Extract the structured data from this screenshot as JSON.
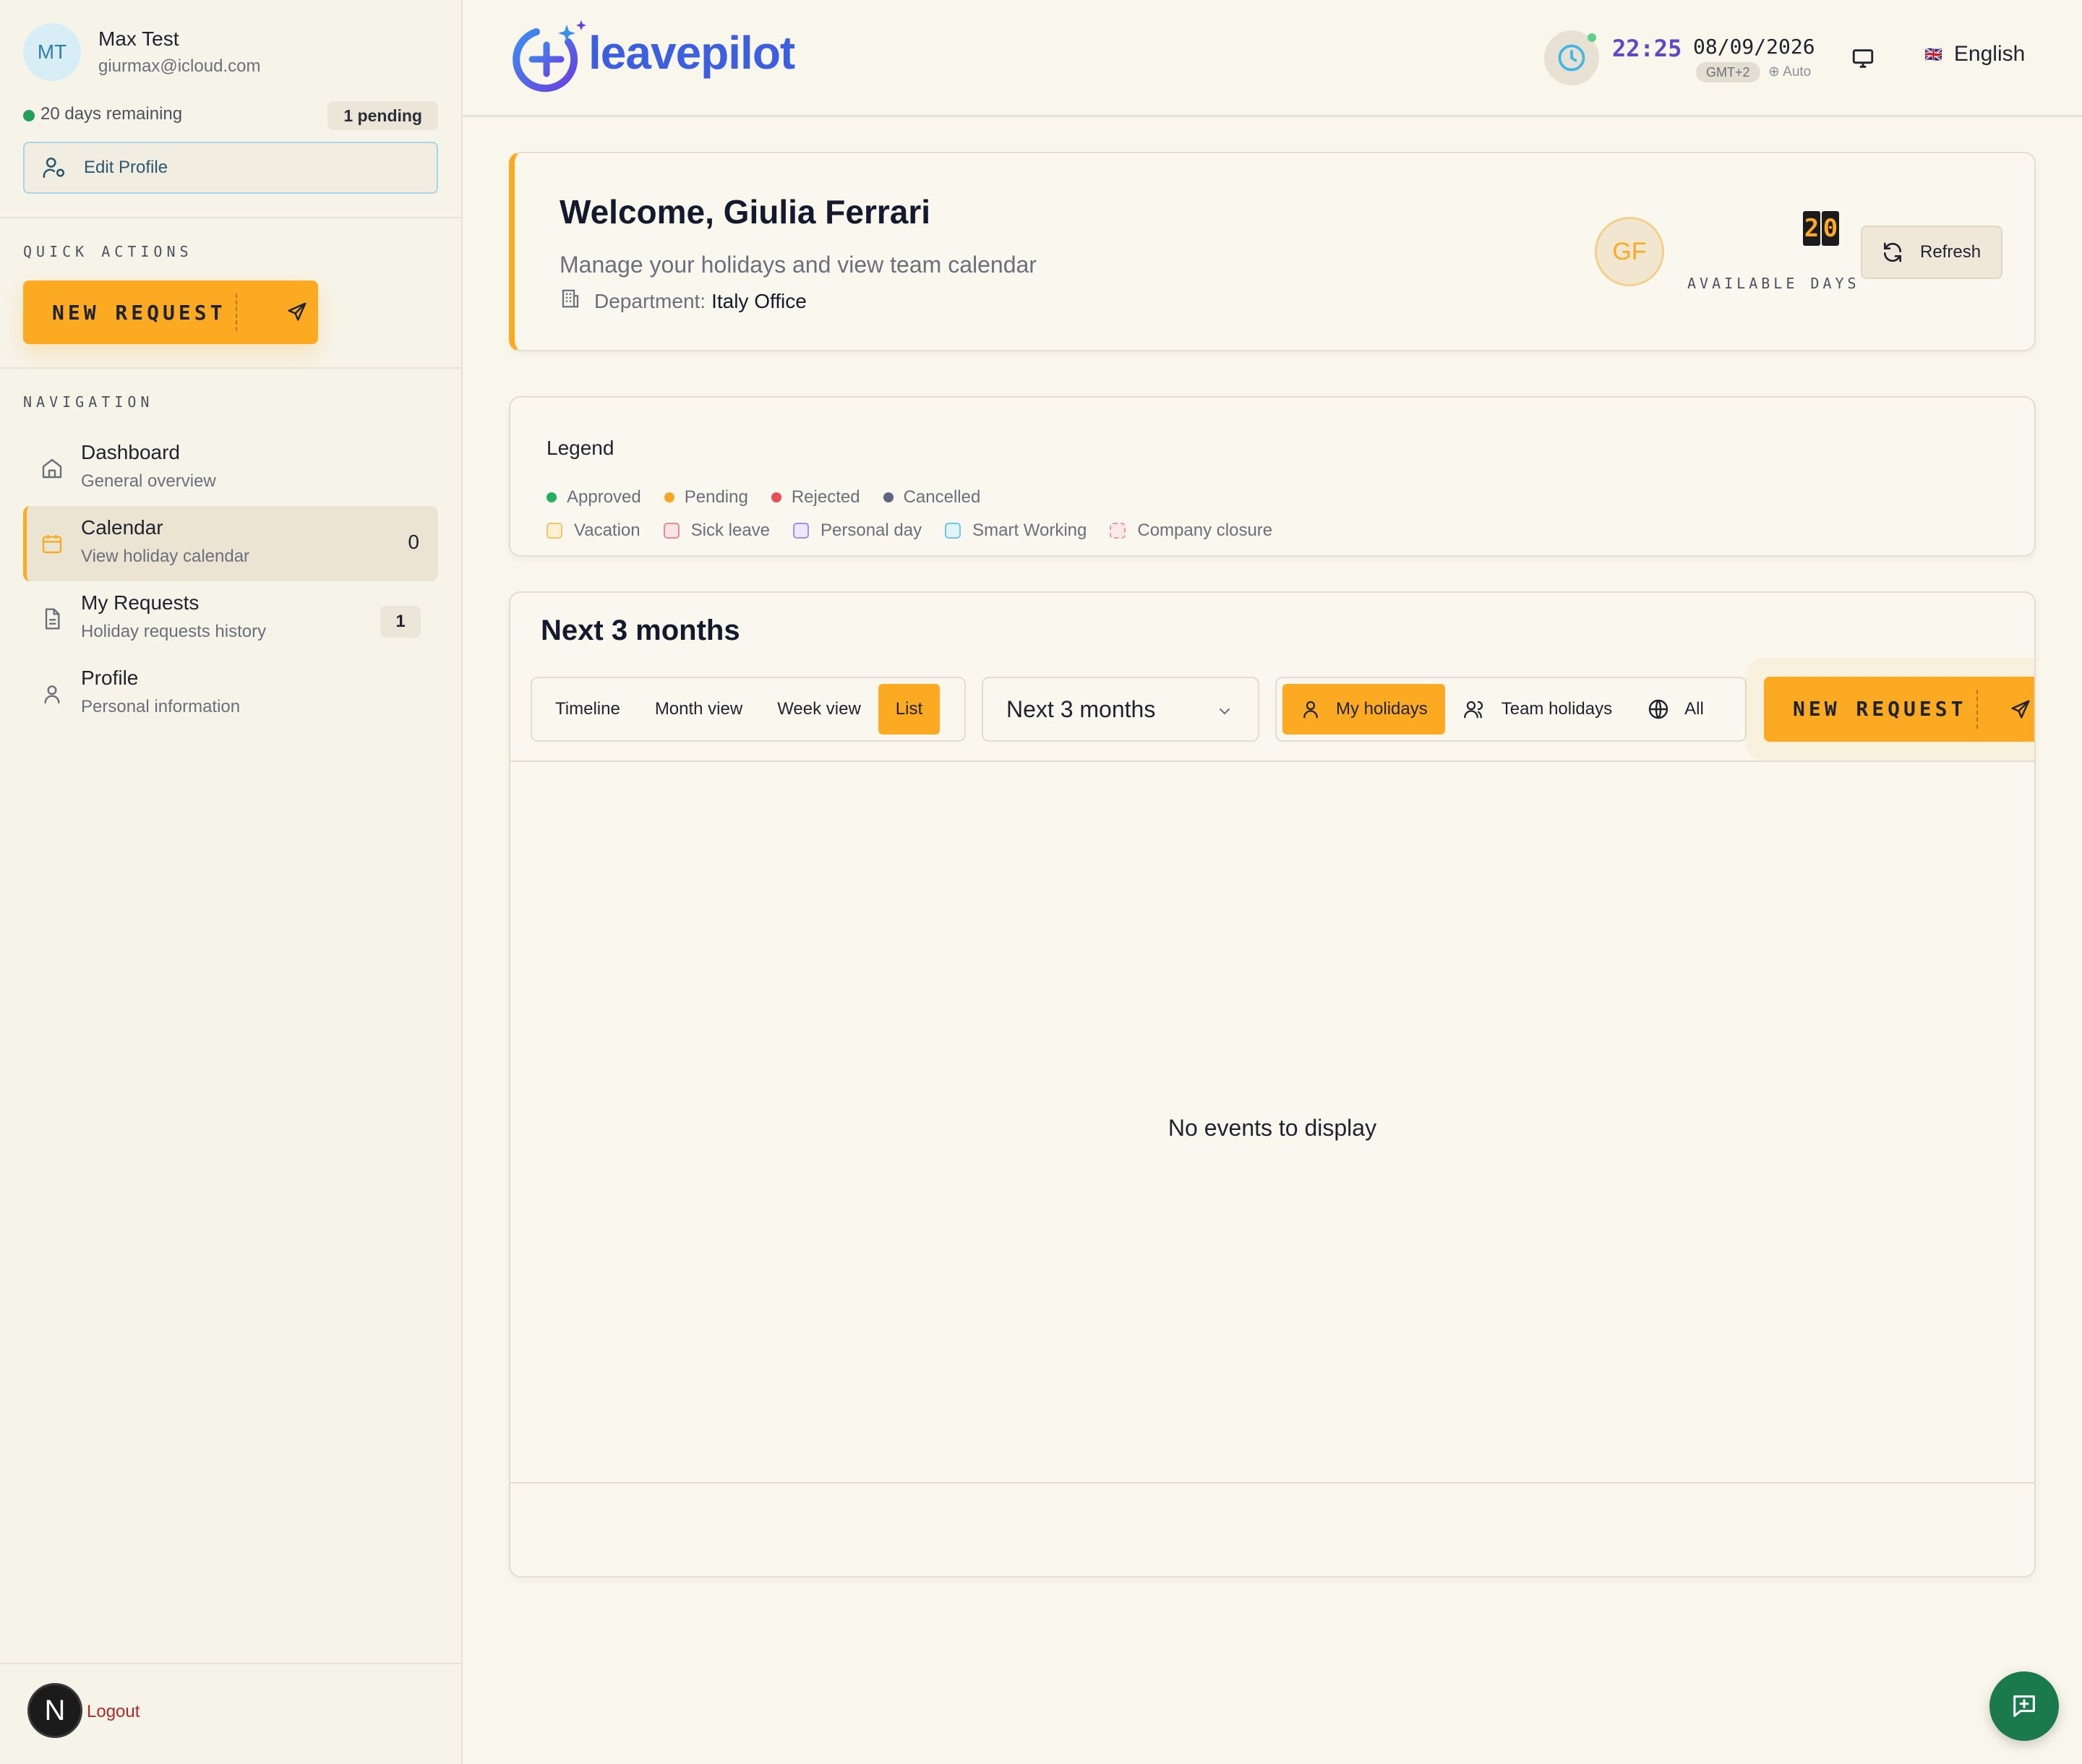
{
  "user": {
    "initials": "MT",
    "name": "Max Test",
    "email": "giurmax@icloud.com",
    "remaining": "20 days remaining",
    "pending": "1 pending",
    "edit_profile": "Edit Profile"
  },
  "quick_actions": {
    "title": "QUICK ACTIONS",
    "new_request": "NEW REQUEST"
  },
  "navigation": {
    "title": "NAVIGATION",
    "items": [
      {
        "title": "Dashboard",
        "sub": "General overview",
        "icon": "home-icon"
      },
      {
        "title": "Calendar",
        "sub": "View holiday calendar",
        "count": "0",
        "icon": "calendar-icon",
        "active": true
      },
      {
        "title": "My Requests",
        "sub": "Holiday requests history",
        "badge": "1",
        "icon": "document-icon"
      },
      {
        "title": "Profile",
        "sub": "Personal information",
        "icon": "user-icon"
      }
    ]
  },
  "logout": {
    "avatar": "N",
    "label": "Logout"
  },
  "header": {
    "logo": "leavepilot",
    "time": "22:25",
    "date": "08/09/2026",
    "timezone": "GMT+2",
    "auto": "Auto",
    "language": "English",
    "flag": "🇬🇧"
  },
  "welcome": {
    "title": "Welcome, Giulia Ferrari",
    "subtitle": "Manage your holidays and view team calendar",
    "department_label": "Department:",
    "department": "Italy Office",
    "initials": "GF",
    "days_digits": [
      "2",
      "0"
    ],
    "available_label": "AVAILABLE DAYS",
    "refresh": "Refresh"
  },
  "legend": {
    "title": "Legend",
    "statuses": [
      {
        "label": "Approved",
        "color": "#22b060"
      },
      {
        "label": "Pending",
        "color": "#f6a623"
      },
      {
        "label": "Rejected",
        "color": "#ea4b55"
      },
      {
        "label": "Cancelled",
        "color": "#5f6680"
      }
    ],
    "types": [
      {
        "label": "Vacation",
        "color": "#f1c667",
        "fill": "#fbf0d4"
      },
      {
        "label": "Sick leave",
        "color": "#e58a96",
        "fill": "#fbe3e6"
      },
      {
        "label": "Personal day",
        "color": "#9b93e6",
        "fill": "#ebe8fb"
      },
      {
        "label": "Smart Working",
        "color": "#6fc6e8",
        "fill": "#e1f3fb"
      },
      {
        "label": "Company closure",
        "color": "#e79a9a",
        "fill": "#fbe8e8"
      }
    ]
  },
  "calendar": {
    "title": "Next 3 months",
    "views": [
      "Timeline",
      "Month view",
      "Week view",
      "List"
    ],
    "active_view": "List",
    "range": "Next 3 months",
    "filters": [
      "My holidays",
      "Team holidays",
      "All"
    ],
    "active_filter": "My holidays",
    "new_request": "NEW REQUEST",
    "empty": "No events to display"
  }
}
